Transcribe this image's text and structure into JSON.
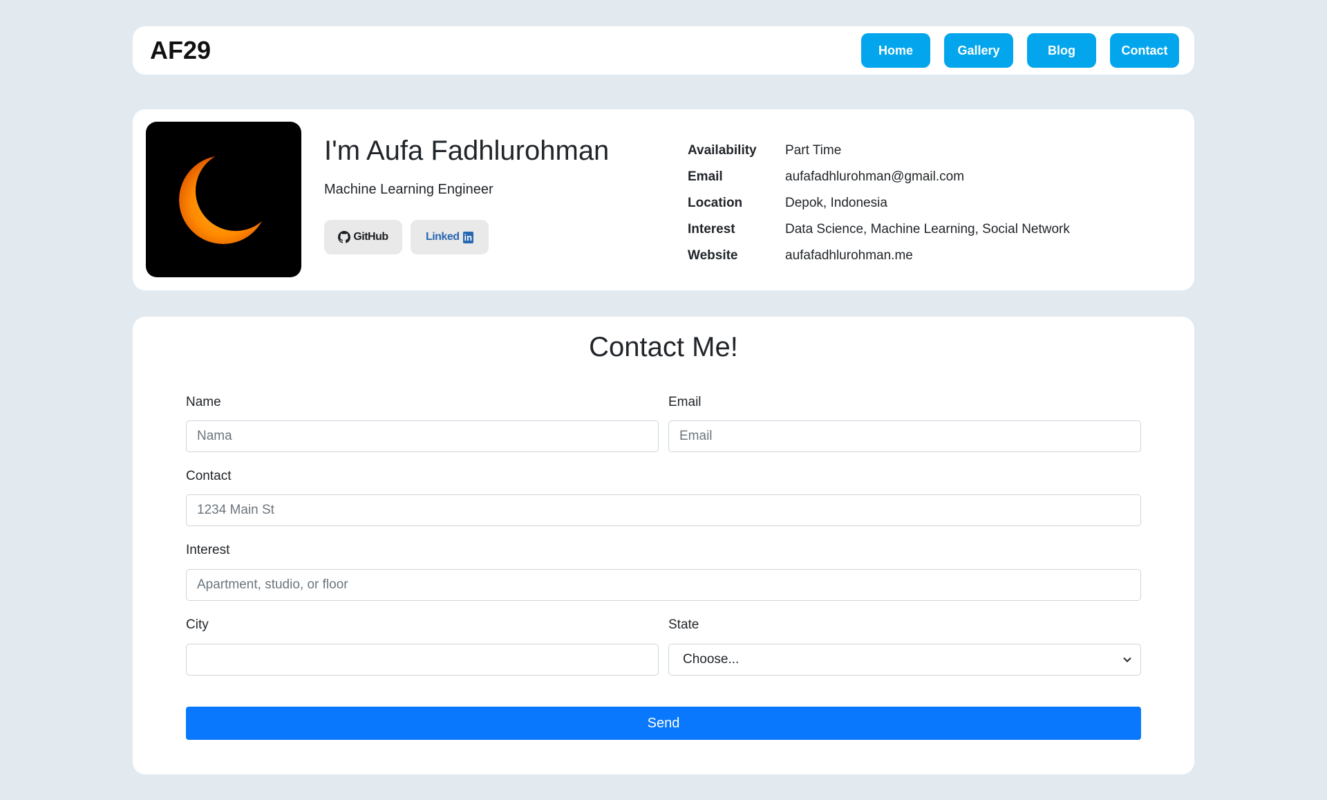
{
  "navbar": {
    "brand": "AF29",
    "links": [
      "Home",
      "Gallery",
      "Blog",
      "Contact"
    ]
  },
  "profile": {
    "name": "I'm Aufa Fadhlurohman",
    "role": "Machine Learning Engineer",
    "social": {
      "github_label": "GitHub",
      "linkedin_label": "Linked",
      "linkedin_badge": "in"
    },
    "info": [
      {
        "key": "Availability",
        "value": "Part Time"
      },
      {
        "key": "Email",
        "value": "aufafadhlurohman@gmail.com"
      },
      {
        "key": "Location",
        "value": "Depok, Indonesia"
      },
      {
        "key": "Interest",
        "value": "Data Science, Machine Learning, Social Network"
      },
      {
        "key": "Website",
        "value": "aufafadhlurohman.me"
      }
    ]
  },
  "contact": {
    "title": "Contact Me!",
    "fields": {
      "name": {
        "label": "Name",
        "placeholder": "Nama"
      },
      "email": {
        "label": "Email",
        "placeholder": "Email"
      },
      "contact": {
        "label": "Contact",
        "placeholder": "1234 Main St"
      },
      "interest": {
        "label": "Interest",
        "placeholder": "Apartment, studio, or floor"
      },
      "city": {
        "label": "City",
        "placeholder": ""
      },
      "state": {
        "label": "State",
        "selected": "Choose..."
      }
    },
    "send_label": "Send"
  },
  "colors": {
    "background": "#e2e9ef",
    "nav_button": "#03a6ec",
    "send_button": "#0a78fc",
    "linkedin": "#2867b2"
  },
  "icons": {
    "github": "github-icon",
    "avatar_image": "crescent-moon-icon",
    "select_arrow": "chevron-down-icon"
  }
}
